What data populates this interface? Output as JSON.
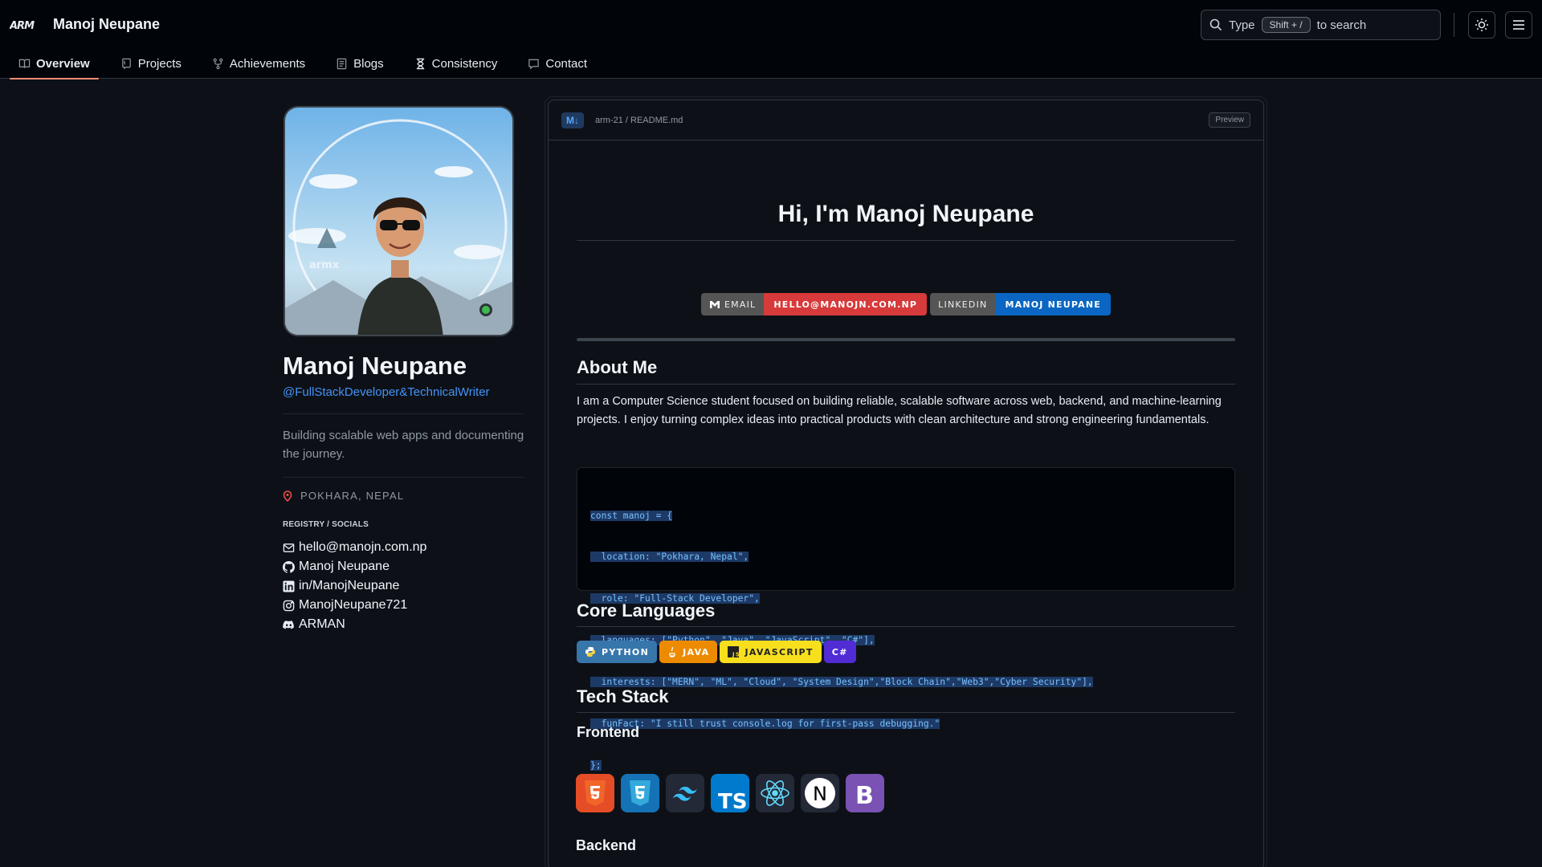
{
  "header": {
    "site_title": "Manoj Neupane",
    "search": {
      "prefix": "Type",
      "shortcut": "Shift + /",
      "suffix": "to search"
    }
  },
  "tabs": [
    {
      "label": "Overview",
      "icon": "book-icon",
      "active": true
    },
    {
      "label": "Projects",
      "icon": "repo-icon"
    },
    {
      "label": "Achievements",
      "icon": "branch-icon"
    },
    {
      "label": "Blogs",
      "icon": "note-icon"
    },
    {
      "label": "Consistency",
      "icon": "hourglass-icon"
    },
    {
      "label": "Contact",
      "icon": "comment-icon"
    }
  ],
  "profile": {
    "name": "Manoj Neupane",
    "handle": "@FullStackDeveloper&TechnicalWriter",
    "bio": "Building scalable web apps and documenting the journey.",
    "location": "POKHARA, NEPAL",
    "registry_heading": "REGISTRY / SOCIALS",
    "socials": [
      {
        "icon": "mail-icon",
        "text": "hello@manojn.com.np"
      },
      {
        "icon": "github-icon",
        "text": "Manoj Neupane"
      },
      {
        "icon": "linkedin-icon",
        "text": "in/ManojNeupane"
      },
      {
        "icon": "instagram-icon",
        "text": "ManojNeupane721"
      },
      {
        "icon": "discord-icon",
        "text": "ARMAN"
      }
    ]
  },
  "readme": {
    "md_badge": "M↓",
    "path": "arm-21 / README.md",
    "preview_label": "Preview",
    "title": "Hi, I'm Manoj Neupane",
    "badges": [
      {
        "label": "EMAIL",
        "value": "HELLO@MANOJN.COM.NP",
        "color": "#d73a3a"
      },
      {
        "label": "LINKEDIN",
        "value": "MANOJ NEUPANE",
        "color": "#0a66c2"
      }
    ],
    "about_heading": "About Me",
    "about_text": "I am a Computer Science student focused on building reliable, scalable software across web, backend, and machine-learning projects. I enjoy turning complex ideas into practical products with clean architecture and strong engineering fundamentals.",
    "code_lines": [
      "const manoj = {",
      "  location: \"Pokhara, Nepal\",",
      "  role: \"Full-Stack Developer\",",
      "  languages: [\"Python\", \"Java\", \"JavaScript\", \"C#\"],",
      "  interests: [\"MERN\", \"ML\", \"Cloud\", \"System Design\",\"Block Chain\",\"Web3\",\"Cyber Security\"],",
      "  funFact: \"I still trust console.log for first-pass debugging.\"",
      "};"
    ],
    "core_heading": "Core Languages",
    "languages": [
      {
        "label": "PYTHON",
        "color": "#3776ab",
        "icon": "python-icon"
      },
      {
        "label": "JAVA",
        "color": "#ed8b00",
        "icon": "java-icon"
      },
      {
        "label": "JAVASCRIPT",
        "color": "#f7df1e",
        "icon": "javascript-icon"
      },
      {
        "label": "C#",
        "color": "#512bd4",
        "icon": ""
      }
    ],
    "tech_heading": "Tech Stack",
    "frontend_heading": "Frontend",
    "frontend_icons": [
      "html5-icon",
      "css3-icon",
      "tailwind-icon",
      "typescript-icon",
      "react-icon",
      "nextjs-icon",
      "bootstrap-icon"
    ],
    "backend_heading": "Backend"
  }
}
